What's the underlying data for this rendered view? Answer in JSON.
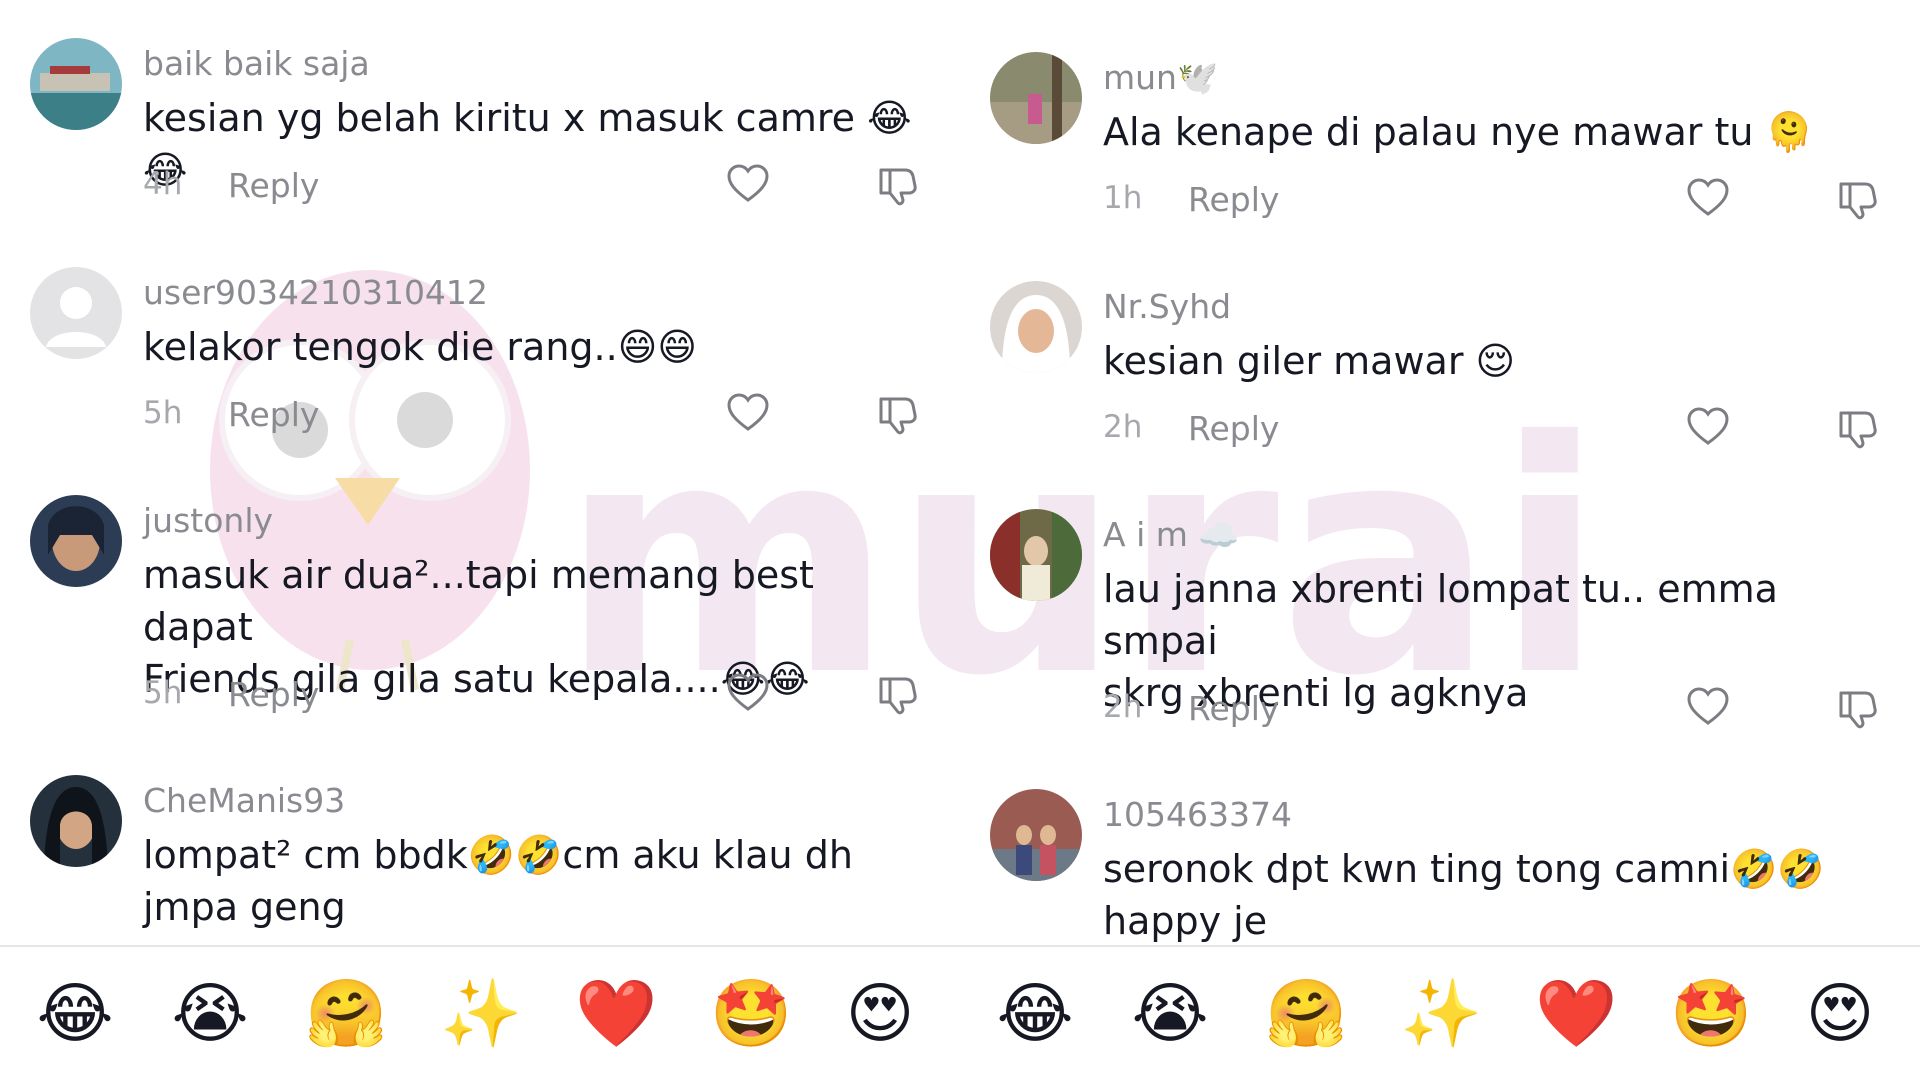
{
  "left": {
    "comments": [
      {
        "username": "baik baik saja",
        "text": "kesian yg belah kiritu x masuk camre 😂😂",
        "time": "4h",
        "reply": "Reply"
      },
      {
        "username": "user9034210310412",
        "text": "kelakor tengok die rang..😄😄",
        "time": "5h",
        "reply": "Reply"
      },
      {
        "username": "justonly",
        "text": "masuk air dua²...tapi memang best dapat\nFriends gila gila satu kepala....😂😂",
        "time": "5h",
        "reply": "Reply"
      },
      {
        "username": "CheManis93",
        "text": "lompat² cm bbdk🤣🤣cm aku klau dh\njmpa geng",
        "time": "",
        "reply": ""
      }
    ],
    "emojis": [
      "😂",
      "😭",
      "🤗",
      "✨",
      "❤️",
      "🤩",
      "😍"
    ]
  },
  "right": {
    "comments": [
      {
        "username": "mun🕊️",
        "text": "Ala kenape di palau nye mawar tu 🫠",
        "time": "1h",
        "reply": "Reply"
      },
      {
        "username": "Nr.Syhd",
        "text": "kesian giler mawar 😌",
        "time": "2h",
        "reply": "Reply"
      },
      {
        "username": "A i m ☁️",
        "text": "lau janna xbrenti lompat tu.. emma smpai\nskrg xbrenti lg agknya",
        "time": "2h",
        "reply": "Reply"
      },
      {
        "username": "105463374",
        "text": "seronok dpt kwn ting tong camni🤣🤣\nhappy je",
        "time": "",
        "reply": ""
      }
    ],
    "emojis": [
      "😂",
      "😭",
      "🤗",
      "✨",
      "❤️",
      "🤩",
      "😍"
    ]
  },
  "watermark": {
    "text": "murai",
    "color": "#e9d6e6"
  }
}
